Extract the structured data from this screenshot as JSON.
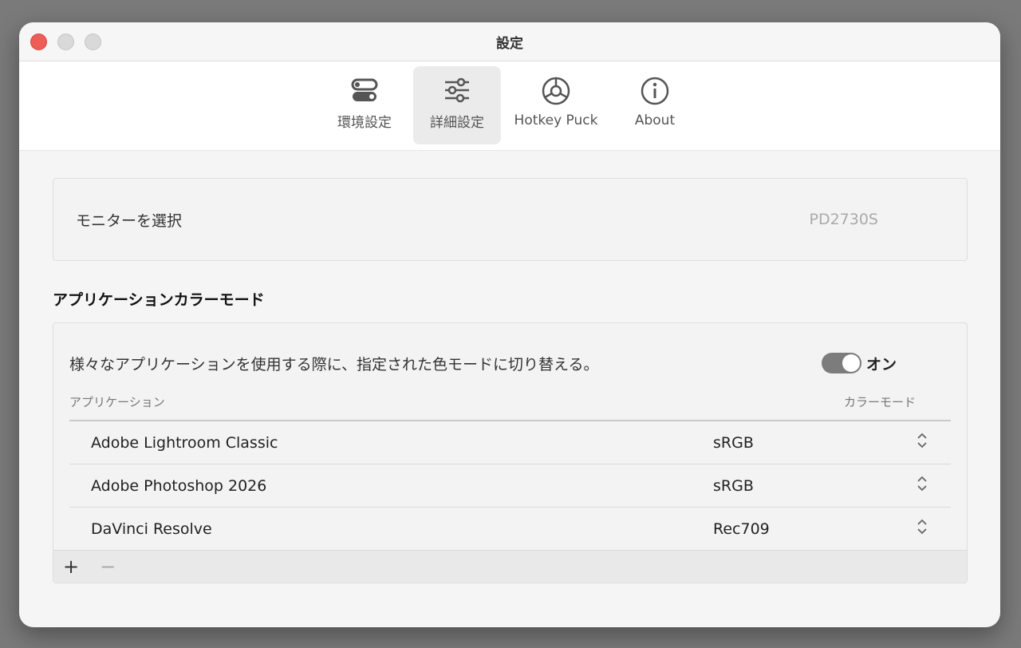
{
  "window": {
    "title": "設定"
  },
  "toolbar": {
    "tabs": [
      {
        "label": "環境設定",
        "icon": "toggles-icon"
      },
      {
        "label": "詳細設定",
        "icon": "sliders-icon",
        "selected": true
      },
      {
        "label": "Hotkey Puck",
        "icon": "puck-icon"
      },
      {
        "label": "About",
        "icon": "info-icon"
      }
    ]
  },
  "monitor": {
    "label": "モニターを選択",
    "value": "PD2730S"
  },
  "app_color_mode": {
    "title": "アプリケーションカラーモード",
    "description": "様々なアプリケーションを使用する際に、指定された色モードに切り替える。",
    "toggle_label": "オン",
    "toggle_on": true,
    "table": {
      "headers": {
        "app": "アプリケーション",
        "mode": "カラーモード"
      },
      "rows": [
        {
          "app": "Adobe Lightroom Classic",
          "mode": "sRGB"
        },
        {
          "app": "Adobe Photoshop 2026",
          "mode": "sRGB"
        },
        {
          "app": "DaVinci Resolve",
          "mode": "Rec709"
        }
      ]
    },
    "footer": {
      "add": "+",
      "remove": "−"
    }
  },
  "colors": {
    "close": "#ee5d57",
    "toggle": "#7c7c7c",
    "selected_tab": "#ebebeb"
  }
}
